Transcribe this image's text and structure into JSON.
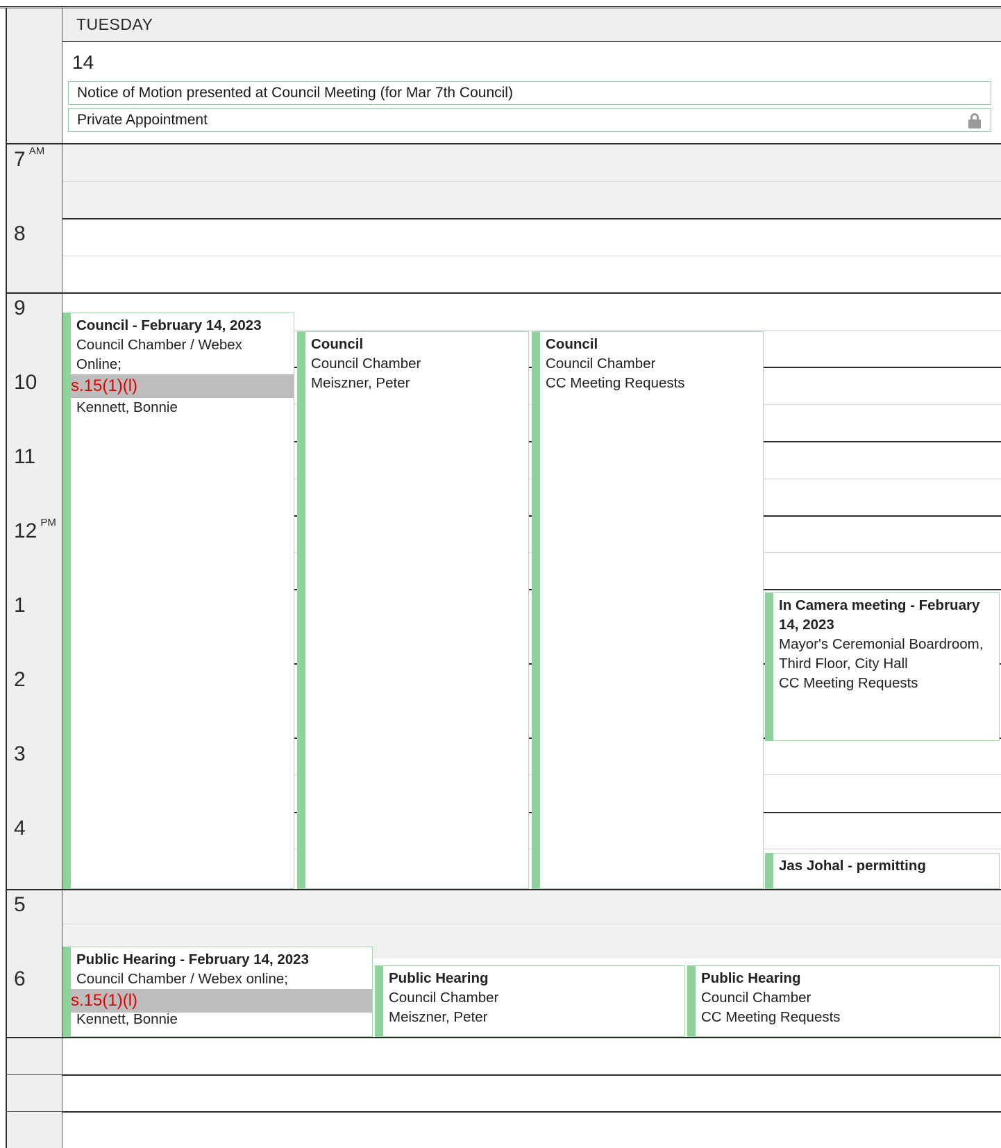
{
  "day": {
    "name": "TUESDAY",
    "number": "14"
  },
  "all_day_events": [
    {
      "title": "Notice of Motion presented at Council Meeting (for Mar 7th Council)",
      "private": false
    },
    {
      "title": "Private Appointment",
      "private": true,
      "icon": "lock-icon"
    }
  ],
  "hours": [
    {
      "label": "7",
      "suffix": "AM"
    },
    {
      "label": "8",
      "suffix": ""
    },
    {
      "label": "9",
      "suffix": ""
    },
    {
      "label": "10",
      "suffix": ""
    },
    {
      "label": "11",
      "suffix": ""
    },
    {
      "label": "12",
      "suffix": "PM"
    },
    {
      "label": "1",
      "suffix": ""
    },
    {
      "label": "2",
      "suffix": ""
    },
    {
      "label": "3",
      "suffix": ""
    },
    {
      "label": "4",
      "suffix": ""
    },
    {
      "label": "5",
      "suffix": ""
    },
    {
      "label": "6",
      "suffix": ""
    }
  ],
  "events": [
    {
      "title": "Council - February 14, 2023",
      "lines": [
        "Council Chamber / Webex",
        "Online;"
      ],
      "redacted": "s.15(1)(l)",
      "after": [
        "Kennett, Bonnie"
      ]
    },
    {
      "title": "Council",
      "lines": [
        "Council Chamber",
        "Meiszner, Peter"
      ]
    },
    {
      "title": "Council",
      "lines": [
        "Council Chamber",
        "CC Meeting Requests"
      ]
    },
    {
      "title": "In Camera meeting - February 14, 2023",
      "lines": [
        "Mayor's Ceremonial Boardroom, Third Floor, City Hall",
        "CC Meeting Requests"
      ]
    },
    {
      "title": "Jas Johal - permitting",
      "lines": []
    },
    {
      "title": "Public Hearing - February 14, 2023",
      "lines": [
        "Council Chamber / Webex online;"
      ],
      "redacted": "s.15(1)(l)",
      "after": [
        "Kennett, Bonnie"
      ]
    },
    {
      "title": "Public Hearing",
      "lines": [
        "Council Chamber",
        "Meiszner, Peter"
      ]
    },
    {
      "title": "Public Hearing",
      "lines": [
        "Council Chamber",
        "CC Meeting Requests"
      ]
    }
  ],
  "colors": {
    "event_accent": "#8fd39c",
    "redaction_text": "#e00000",
    "redaction_bg": "#bdbdbd"
  }
}
